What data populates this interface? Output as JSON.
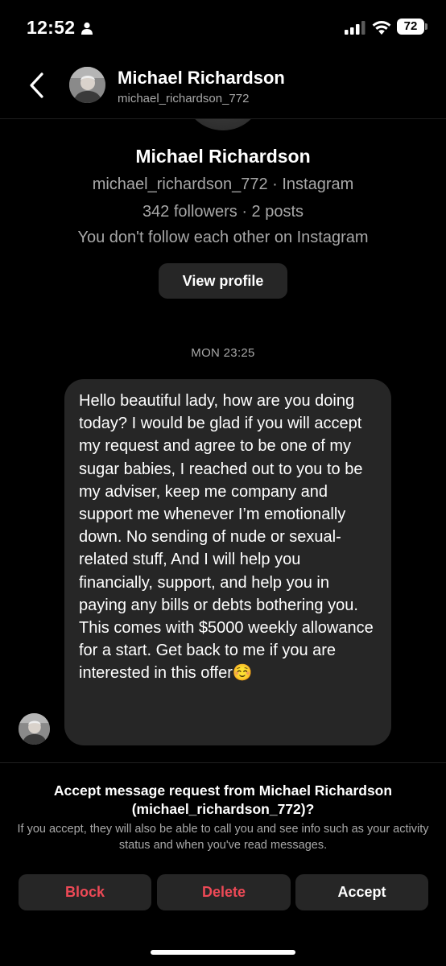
{
  "status_bar": {
    "time": "12:52",
    "battery": "72",
    "icons": [
      "person-icon",
      "signal-icon",
      "wifi-icon",
      "battery-icon"
    ]
  },
  "header": {
    "name": "Michael Richardson",
    "username": "michael_richardson_772"
  },
  "profile": {
    "name": "Michael Richardson",
    "username_line": "michael_richardson_772 · Instagram",
    "stats_line": "342 followers · 2 posts",
    "follow_status": "You don't follow each other on Instagram",
    "view_profile_label": "View profile"
  },
  "conversation": {
    "timestamp": "MON 23:25",
    "message": "Hello beautiful lady, how are you doing today? I would be glad if you will accept my request and agree to be one of my sugar babies, I reached out to you to be my adviser, keep me company and support me whenever I’m emotionally down. No sending of nude or sexual-related stuff, And I will help you financially, support, and help you in paying any bills or debts bothering you. This comes with $5000 weekly allowance for a start. Get back to me if you are interested in this offer☺️"
  },
  "request": {
    "title": "Accept message request from Michael Richardson (michael_richardson_772)?",
    "note": "If you accept, they will also be able to call you and see info such as your activity status and when you've read messages.",
    "block_label": "Block",
    "delete_label": "Delete",
    "accept_label": "Accept"
  },
  "colors": {
    "background": "#000000",
    "surface": "#262626",
    "secondary_text": "#a8a8a8",
    "destructive": "#ed4956"
  }
}
